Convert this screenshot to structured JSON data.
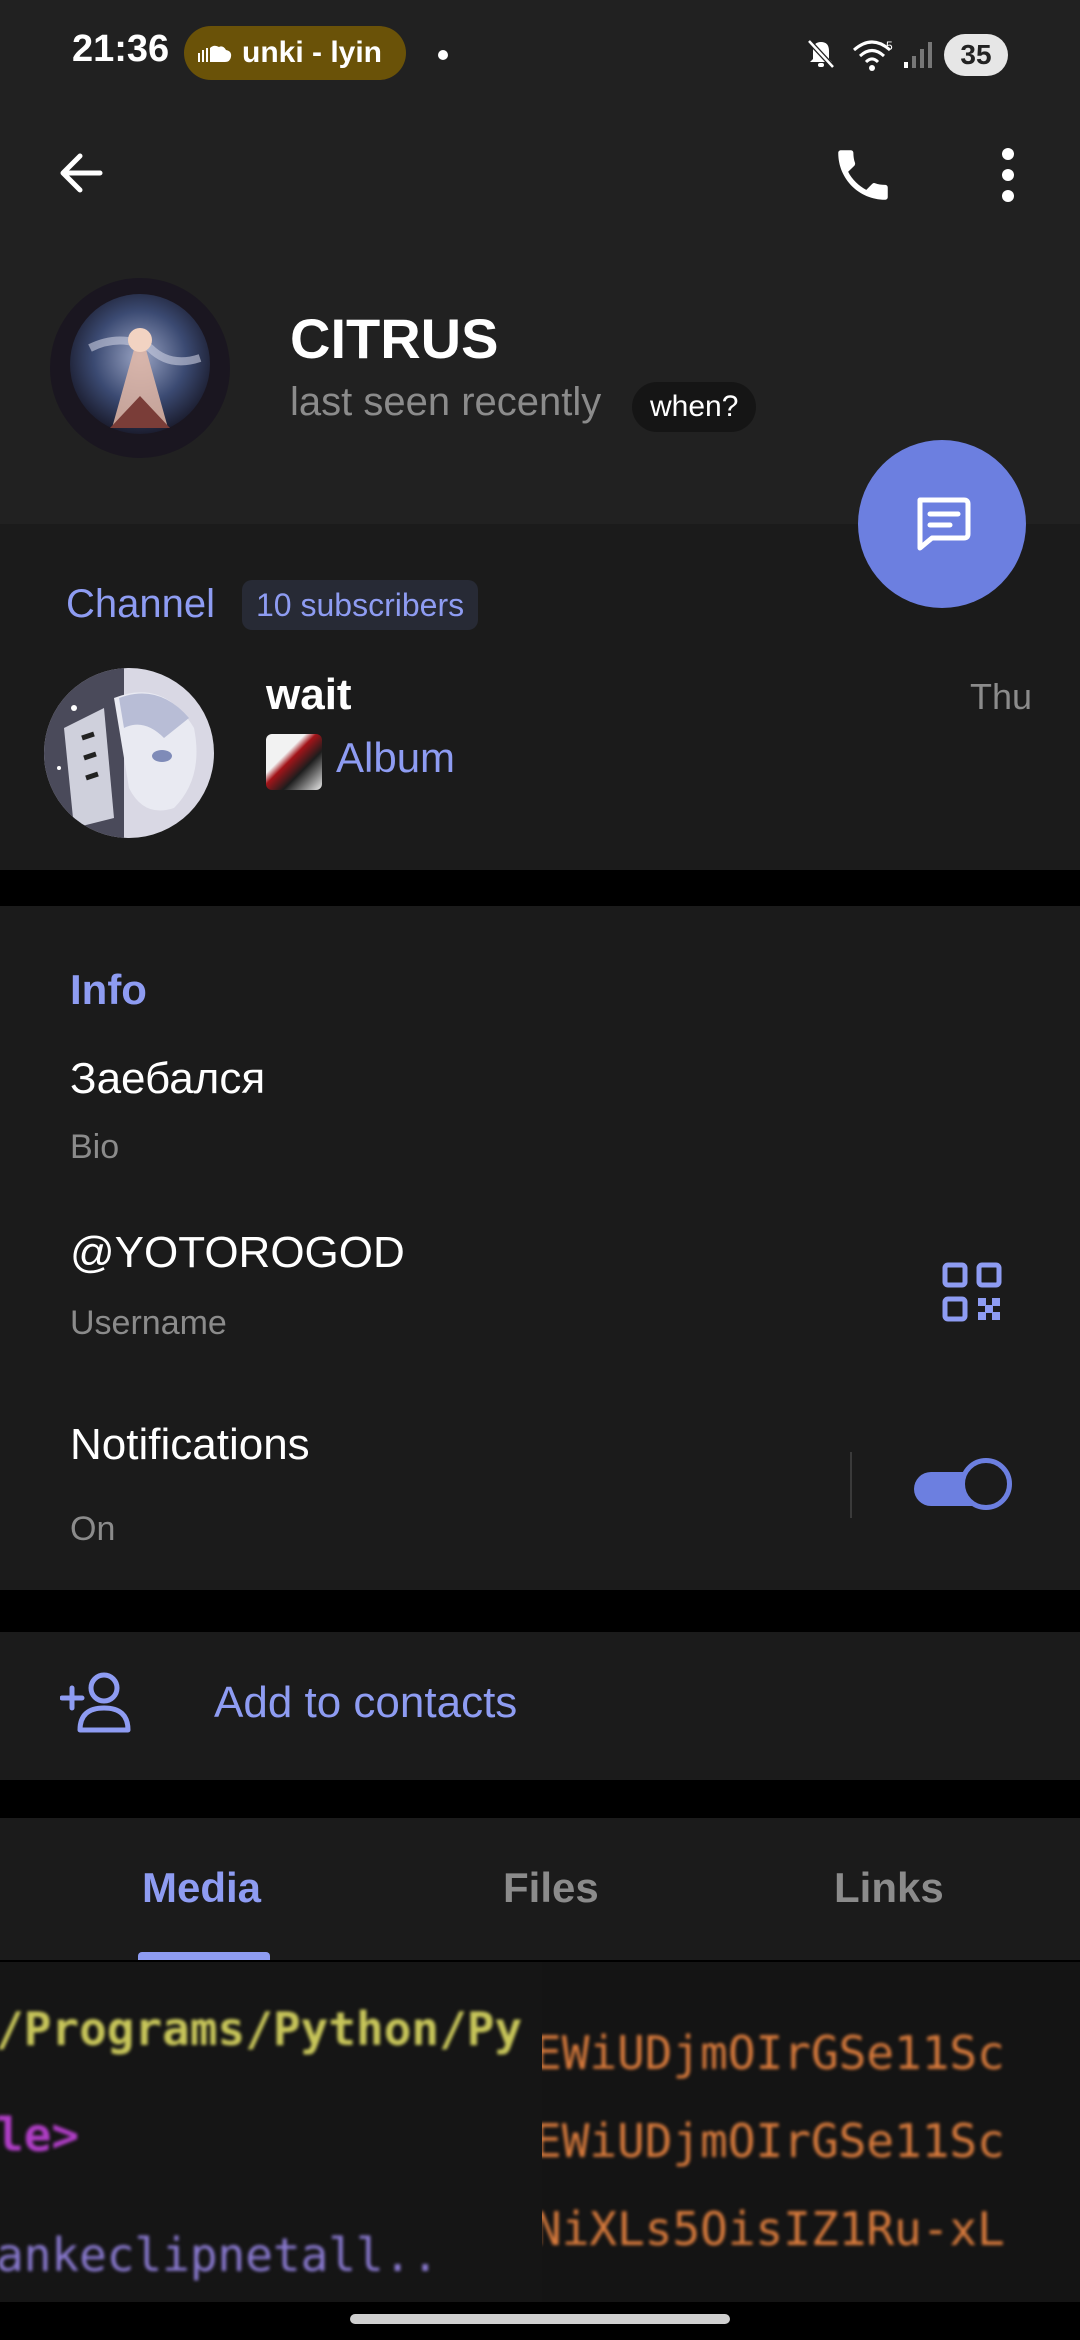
{
  "status_bar": {
    "time": "21:36",
    "media_pill": "unki - lyin",
    "battery": "35"
  },
  "header": {
    "name": "CITRUS",
    "last_seen": "last seen recently",
    "when_chip": "when?"
  },
  "channel": {
    "section_label": "Channel",
    "subscribers": "10 subscribers",
    "post_title": "wait",
    "post_date": "Thu",
    "post_preview": "Album"
  },
  "info": {
    "section_label": "Info",
    "bio_value": "Заебался",
    "bio_label": "Bio",
    "username_value": "@YOTOROGOD",
    "username_label": "Username",
    "notifications_value": "Notifications",
    "notifications_state": "On",
    "notifications_enabled": true
  },
  "actions": {
    "add_to_contacts": "Add to contacts"
  },
  "tabs": [
    {
      "label": "Media",
      "active": true
    },
    {
      "label": "Files",
      "active": false
    },
    {
      "label": "Links",
      "active": false
    }
  ],
  "media_thumbs": {
    "thumb1_line1": "/Programs/Python/Py",
    "thumb1_line2": "le>",
    "thumb2_line1": "EWiUDjmOIrGSe11Sc",
    "thumb2_line2": "EWiUDjmOIrGSe11Sc",
    "thumb2_line3": "NiXLs5OisIZ1Ru-xL"
  },
  "colors": {
    "accent": "#8e9cf2",
    "fab": "#6c7fe0",
    "background": "#1b1b1b",
    "header_bg": "#212121"
  }
}
